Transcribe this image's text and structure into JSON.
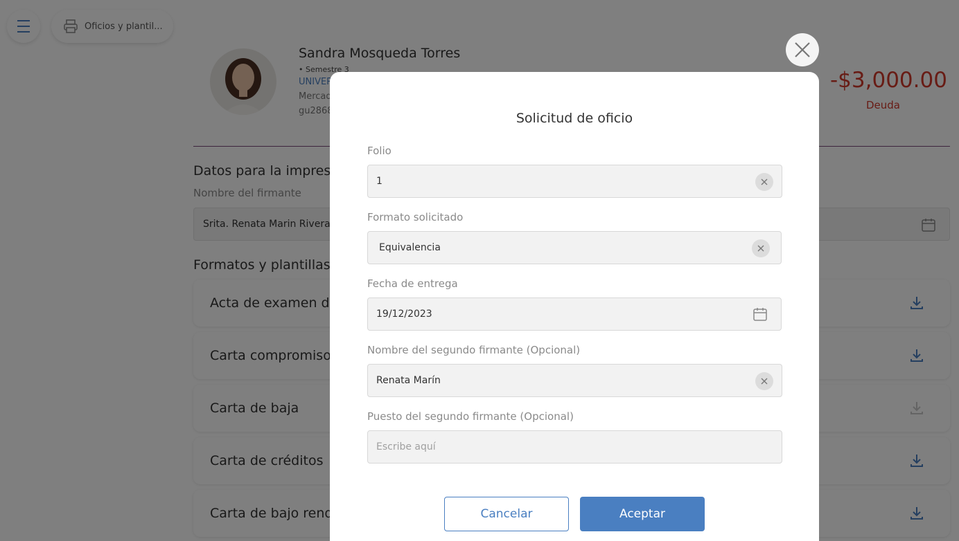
{
  "nav": {
    "breadcrumb": "Oficios y plantil..."
  },
  "student": {
    "name": "Sandra Mosqueda Torres",
    "semester": "• Semestre 3",
    "university": "UNIVER",
    "program": "Mercad",
    "id": "gu2868"
  },
  "debt": {
    "amount": "-$3,000.00",
    "label": "Deuda"
  },
  "print_section": {
    "title": "Datos para la impresió",
    "signer_label": "Nombre del firmante",
    "signer_value": "Srita. Renata Marin Rivera"
  },
  "templates_section": {
    "title": "Formatos y plantillas d",
    "items": [
      {
        "label": "Acta de examen de"
      },
      {
        "label": "Carta compromiso"
      },
      {
        "label": "Carta de baja"
      },
      {
        "label": "Carta de créditos"
      },
      {
        "label": "Carta de bajo rendi"
      }
    ]
  },
  "modal": {
    "title": "Solicitud de oficio",
    "folio_label": "Folio",
    "folio_value": "1",
    "format_label": "Formato solicitado",
    "format_value": "Equivalencia",
    "date_label": "Fecha de entrega",
    "date_value": "19/12/2023",
    "second_signer_label": "Nombre del segundo firmante (Opcional)",
    "second_signer_value": "Renata Marín",
    "position_label": "Puesto del segundo firmante (Opcional)",
    "position_placeholder": "Escribe aquí",
    "cancel_label": "Cancelar",
    "accept_label": "Aceptar"
  },
  "colors": {
    "accent": "#4a7fc1",
    "debt": "#d0382b",
    "overlay": "rgba(0,0,0,0.5)"
  },
  "icons": [
    "menu-icon",
    "printer-icon",
    "calendar-icon",
    "download-icon",
    "close-icon",
    "clear-icon"
  ]
}
